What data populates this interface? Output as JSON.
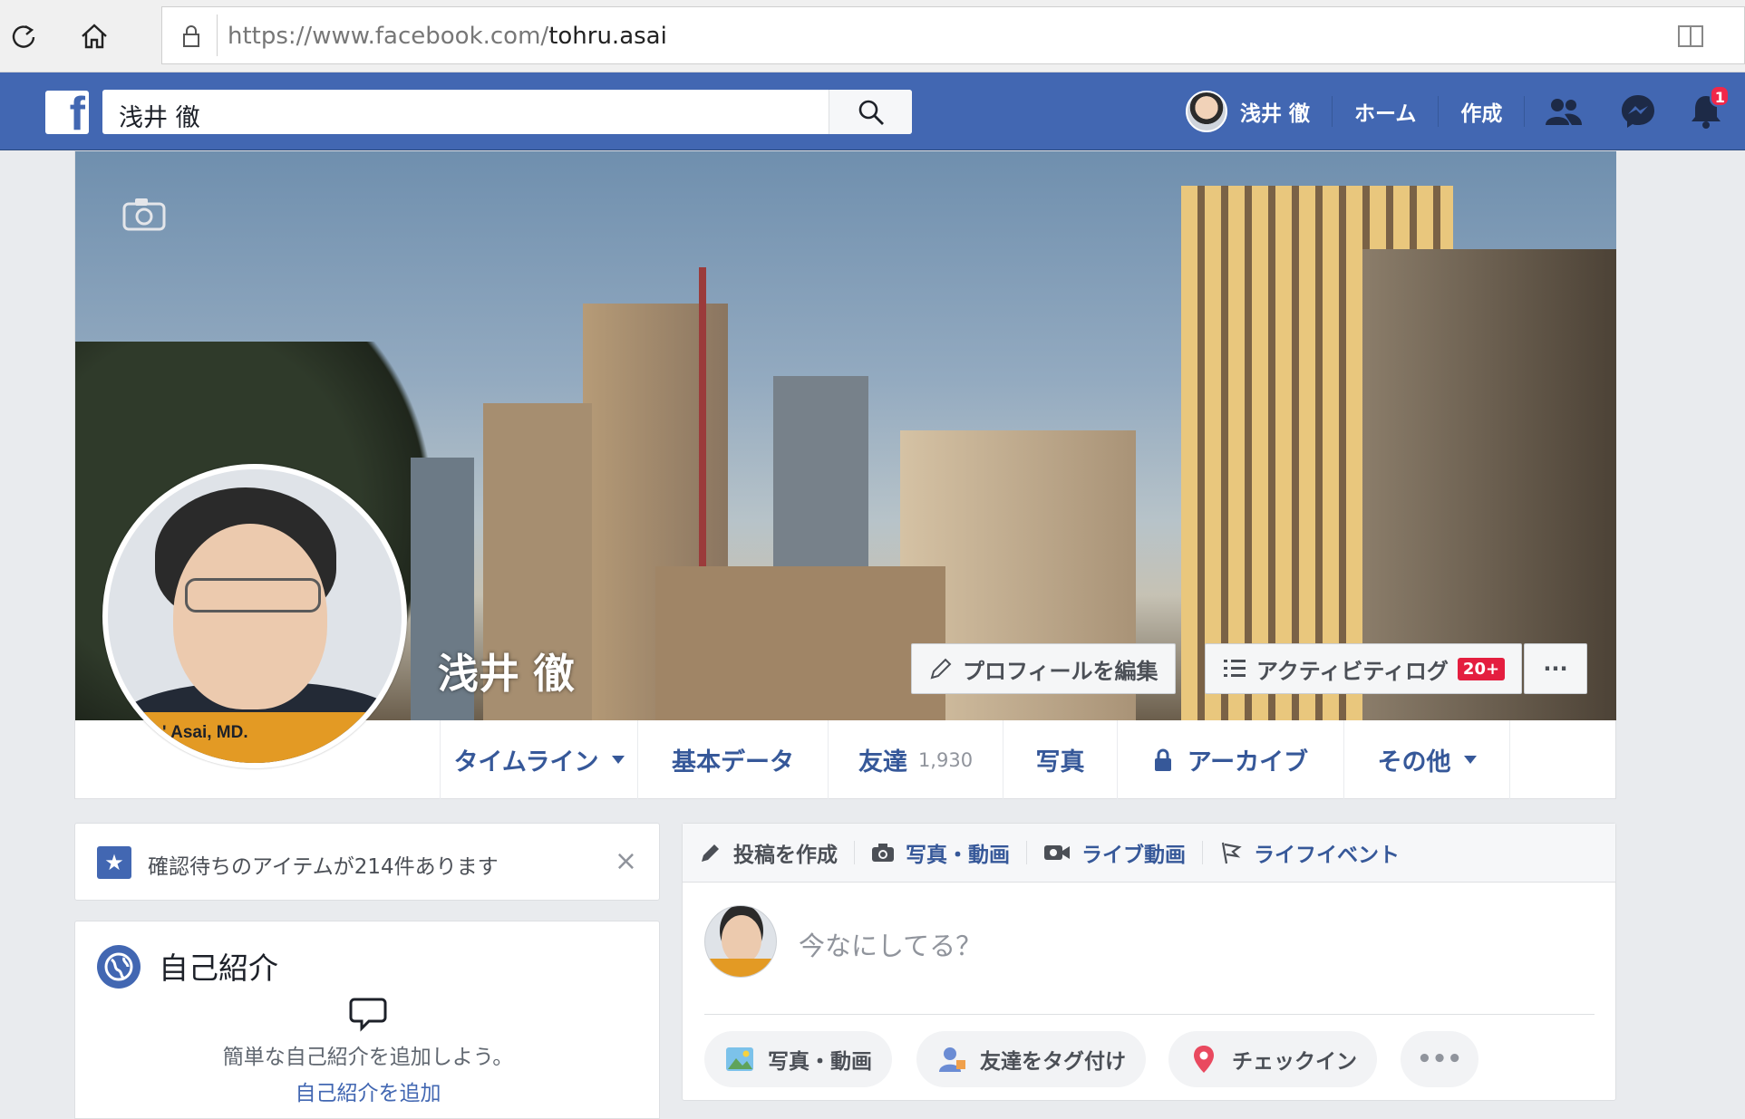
{
  "browser": {
    "url_host": "https://www.facebook.com/",
    "url_path": "tohru.asai"
  },
  "header": {
    "search_value": "浅井 徹",
    "user_name": "浅井 徹",
    "home_label": "ホーム",
    "create_label": "作成",
    "notification_count": "1",
    "logo_letter": "f"
  },
  "profile": {
    "name": "浅井 徹",
    "pic_caption": "' Asai, MD.",
    "edit_profile_label": "プロフィールを編集",
    "activity_log_label": "アクティビティログ",
    "activity_log_badge": "20+",
    "more_label": "···"
  },
  "tabs": [
    {
      "label": "タイムライン"
    },
    {
      "label": "基本データ"
    },
    {
      "label": "友達",
      "count": "1,930"
    },
    {
      "label": "写真"
    },
    {
      "label": "アーカイブ"
    },
    {
      "label": "その他"
    }
  ],
  "pending": {
    "text": "確認待ちのアイテムが214件あります",
    "close": "×"
  },
  "intro": {
    "title": "自己紹介",
    "description": "簡単な自己紹介を追加しよう。",
    "add_link": "自己紹介を追加"
  },
  "composer": {
    "tabs": [
      "投稿を作成",
      "写真・動画",
      "ライブ動画",
      "ライフイベント"
    ],
    "placeholder": "今なにしてる？",
    "actions": [
      "写真・動画",
      "友達をタグ付け",
      "チェックイン"
    ],
    "more": "•••"
  },
  "colors": {
    "fb_blue": "#4267b2",
    "link_blue": "#365899",
    "badge_red": "#e41e3f",
    "ribbon_orange": "#e39a24"
  }
}
